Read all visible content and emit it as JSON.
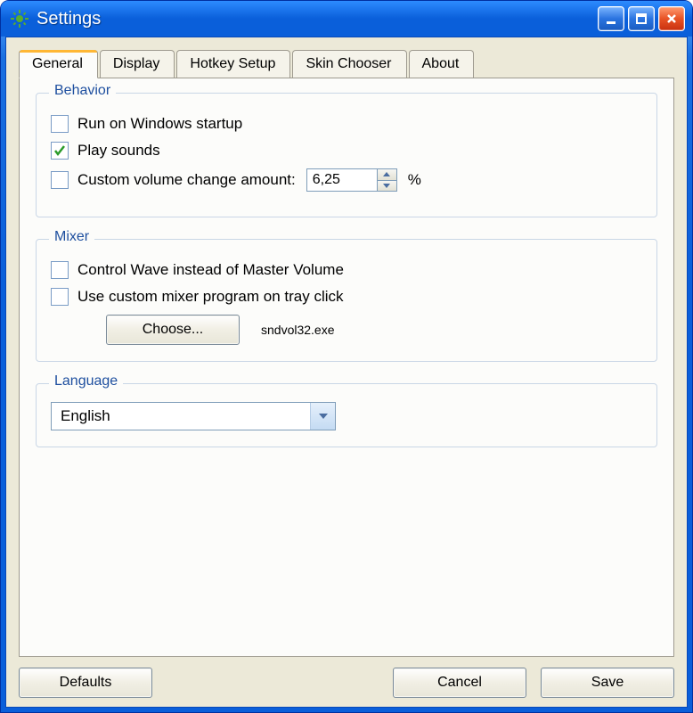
{
  "window": {
    "title": "Settings"
  },
  "tabs": [
    {
      "label": "General"
    },
    {
      "label": "Display"
    },
    {
      "label": "Hotkey Setup"
    },
    {
      "label": "Skin Chooser"
    },
    {
      "label": "About"
    }
  ],
  "groups": {
    "behavior": {
      "title": "Behavior",
      "run_on_startup_label": "Run on Windows startup",
      "play_sounds_label": "Play sounds",
      "custom_volume_label": "Custom volume change amount:",
      "custom_volume_value": "6,25",
      "percent_symbol": "%"
    },
    "mixer": {
      "title": "Mixer",
      "control_wave_label": "Control Wave instead of Master Volume",
      "use_custom_mixer_label": "Use custom mixer program on tray click",
      "choose_button": "Choose...",
      "mixer_program": "sndvol32.exe"
    },
    "language": {
      "title": "Language",
      "selected": "English"
    }
  },
  "buttons": {
    "defaults": "Defaults",
    "cancel": "Cancel",
    "save": "Save"
  }
}
